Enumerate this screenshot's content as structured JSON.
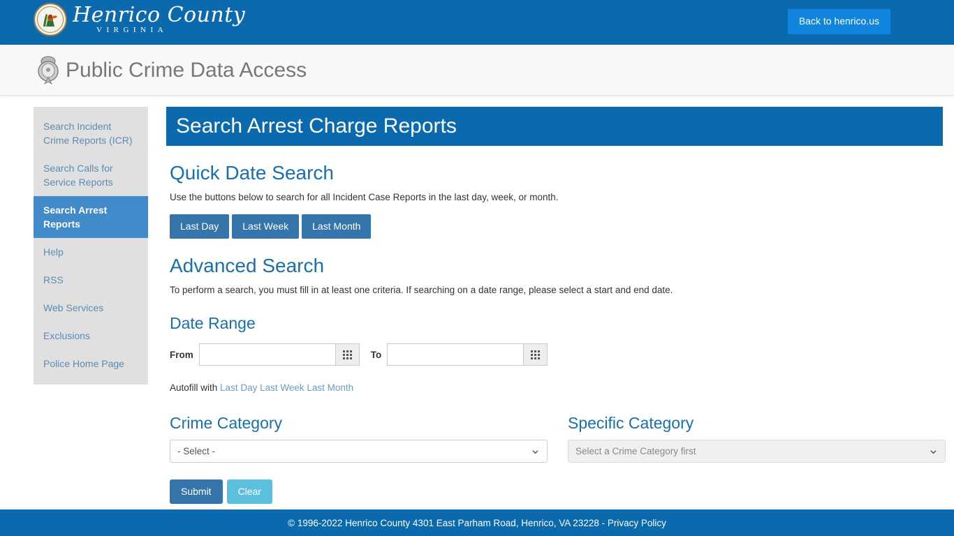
{
  "brand": {
    "county_name": "Henrico County",
    "state_name": "VIRGINIA",
    "back_button_label": "Back to henrico.us",
    "seal_icon": "henrico-county-seal-icon"
  },
  "subheader": {
    "app_title": "Public Crime Data Access",
    "badge_icon": "police-badge-icon"
  },
  "sidebar": {
    "items": [
      {
        "label": "Search Incident Crime Reports (ICR)",
        "name": "sidebar-item-search-incident-crime-reports",
        "active": false
      },
      {
        "label": "Search Calls for Service Reports",
        "name": "sidebar-item-search-calls-for-service-reports",
        "active": false
      },
      {
        "label": "Search Arrest Reports",
        "name": "sidebar-item-search-arrest-reports",
        "active": true
      },
      {
        "label": "Help",
        "name": "sidebar-item-help",
        "active": false
      },
      {
        "label": "RSS",
        "name": "sidebar-item-rss",
        "active": false
      },
      {
        "label": "Web Services",
        "name": "sidebar-item-web-services",
        "active": false
      },
      {
        "label": "Exclusions",
        "name": "sidebar-item-exclusions",
        "active": false
      },
      {
        "label": "Police Home Page",
        "name": "sidebar-item-police-home-page",
        "active": false
      }
    ]
  },
  "main": {
    "page_title": "Search Arrest Charge Reports",
    "quick_date": {
      "heading": "Quick Date Search",
      "description": "Use the buttons below to search for all Incident Case Reports in the last day, week, or month.",
      "buttons": [
        {
          "label": "Last Day",
          "name": "quick-last-day-button"
        },
        {
          "label": "Last Week",
          "name": "quick-last-week-button"
        },
        {
          "label": "Last Month",
          "name": "quick-last-month-button"
        }
      ]
    },
    "advanced": {
      "heading": "Advanced Search",
      "description": "To perform a search, you must fill in at least one criteria. If searching on a date range, please select a start and end date.",
      "date_range": {
        "heading": "Date Range",
        "from_label": "From",
        "from_value": "",
        "from_placeholder": "",
        "to_label": "To",
        "to_value": "",
        "to_placeholder": "",
        "calendar_icon": "calendar-grid-icon"
      },
      "autofill": {
        "prefix": "Autofill with",
        "links": [
          {
            "label": "Last Day",
            "name": "autofill-last-day-link"
          },
          {
            "label": "Last Week",
            "name": "autofill-last-week-link"
          },
          {
            "label": "Last Month",
            "name": "autofill-last-month-link"
          }
        ]
      },
      "crime_category": {
        "heading": "Crime Category",
        "selected": "- Select -",
        "disabled": false
      },
      "specific_category": {
        "heading": "Specific Category",
        "selected": "Select a Crime Category first",
        "disabled": true
      },
      "submit_label": "Submit",
      "clear_label": "Clear"
    }
  },
  "footer": {
    "text": "© 1996-2022 Henrico County 4301 East Parham Road, Henrico, VA 23228 - ",
    "privacy_label": "Privacy Policy"
  },
  "colors": {
    "header_blue": "#0a6aad",
    "accent_blue": "#428bca",
    "link_blue": "#1a6fae",
    "button_blue": "#3575ab",
    "info_blue": "#5bc0de",
    "back_button_blue": "#1185dd",
    "sidebar_gray": "#e0e0e0"
  }
}
